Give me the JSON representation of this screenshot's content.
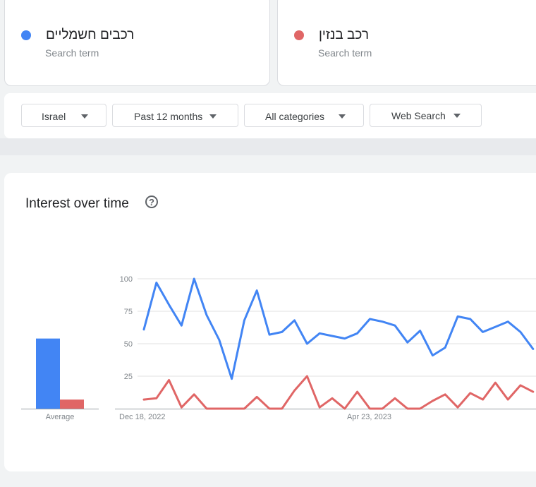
{
  "terms": [
    {
      "name": "רכבים חשמליים",
      "subtitle": "Search term",
      "color": "#4285f4"
    },
    {
      "name": "רכב בנזין",
      "subtitle": "Search term",
      "color": "#e06666"
    }
  ],
  "filters": {
    "region": "Israel",
    "period": "Past 12 months",
    "category": "All categories",
    "search_type": "Web Search"
  },
  "panel": {
    "title": "Interest over time",
    "help_icon": "help-circle-icon"
  },
  "chart_data": {
    "type": "line",
    "title": "Interest over time",
    "ylim": [
      0,
      100
    ],
    "yticks": [
      "100",
      "75",
      "50",
      "25"
    ],
    "xtick_labels": [
      "Dec 18, 2022",
      "Apr 23, 2023"
    ],
    "average": {
      "label": "Average",
      "values": [
        54,
        7
      ]
    },
    "series": [
      {
        "name": "רכבים חשמליים",
        "color": "#4285f4",
        "values": [
          61,
          97,
          80,
          64,
          100,
          72,
          53,
          23,
          68,
          91,
          57,
          59,
          68,
          50,
          58,
          56,
          54,
          58,
          69,
          67,
          64,
          51,
          60,
          41,
          47,
          71,
          69,
          59,
          63,
          67,
          59,
          46
        ]
      },
      {
        "name": "רכב בנזין",
        "color": "#e06666",
        "values": [
          7,
          8,
          22,
          1,
          11,
          0,
          0,
          0,
          0,
          9,
          0,
          0,
          14,
          25,
          1,
          8,
          0,
          13,
          0,
          0,
          8,
          0,
          0,
          6,
          11,
          1,
          12,
          7,
          20,
          7,
          18,
          13
        ]
      }
    ]
  }
}
